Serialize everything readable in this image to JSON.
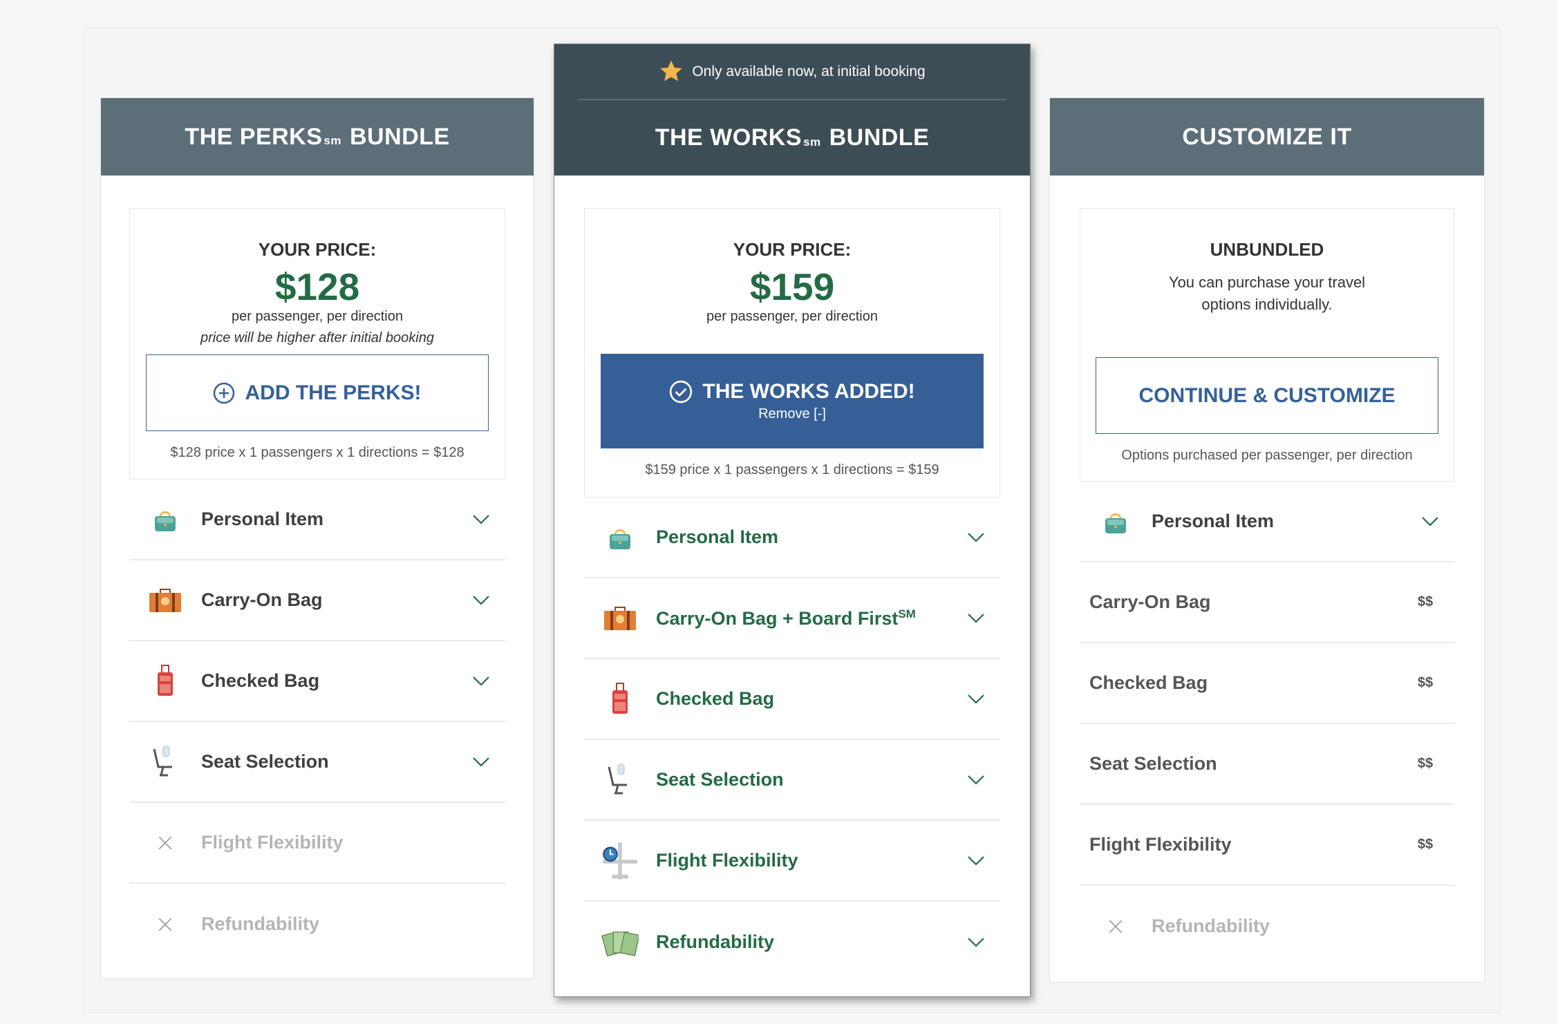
{
  "colors": {
    "header": "#5c6e77",
    "featured_header": "#3d4d56",
    "price_green": "#236b45",
    "button_blue": "#365f98"
  },
  "perks": {
    "title": "THE PERKS",
    "sm": "sm",
    "title2": "BUNDLE",
    "your_price": "YOUR PRICE:",
    "price": "$128",
    "per": "per passenger, per direction",
    "note": "price will be higher after initial booking",
    "button": "ADD THE PERKS!",
    "calc": "$128 price x 1 passengers x 1 directions = $128",
    "items": [
      {
        "label": "Personal Item",
        "icon": "handbag-icon"
      },
      {
        "label": "Carry-On Bag",
        "icon": "suitcase-icon"
      },
      {
        "label": "Checked Bag",
        "icon": "rolling-luggage-icon"
      },
      {
        "label": "Seat Selection",
        "icon": "seat-icon"
      },
      {
        "label": "Flight Flexibility",
        "icon": "x-icon"
      },
      {
        "label": "Refundability",
        "icon": "x-icon"
      }
    ]
  },
  "works": {
    "promo": "Only available now, at initial booking",
    "title": "THE WORKS",
    "sm": "sm",
    "title2": "BUNDLE",
    "your_price": "YOUR PRICE:",
    "price": "$159",
    "per": "per passenger, per direction",
    "button": "THE WORKS ADDED!",
    "remove": "Remove [-]",
    "calc": "$159 price x 1 passengers x 1 directions = $159",
    "items": [
      {
        "label": "Personal Item",
        "icon": "handbag-icon"
      },
      {
        "label": "Carry-On Bag + Board First",
        "sup": "SM",
        "icon": "suitcase-icon"
      },
      {
        "label": "Checked Bag",
        "icon": "rolling-luggage-icon"
      },
      {
        "label": "Seat Selection",
        "icon": "seat-icon"
      },
      {
        "label": "Flight Flexibility",
        "icon": "plane-clock-icon"
      },
      {
        "label": "Refundability",
        "icon": "money-icon"
      }
    ]
  },
  "custom": {
    "title": "CUSTOMIZE IT",
    "heading": "UNBUNDLED",
    "desc": "You can purchase your travel options individually.",
    "button": "CONTINUE & CUSTOMIZE",
    "note": "Options purchased per passenger, per direction",
    "personal": "Personal Item",
    "items": [
      {
        "label": "Carry-On Bag",
        "price": "$$"
      },
      {
        "label": "Checked Bag",
        "price": "$$"
      },
      {
        "label": "Seat Selection",
        "price": "$$"
      },
      {
        "label": "Flight Flexibility",
        "price": "$$"
      }
    ],
    "refund": "Refundability"
  }
}
